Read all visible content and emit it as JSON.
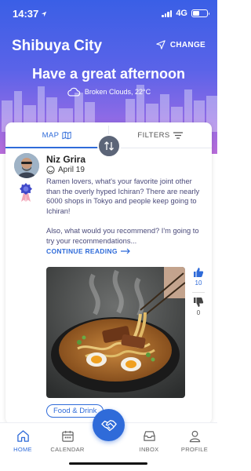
{
  "status_bar": {
    "time": "14:37",
    "network": "4G"
  },
  "header": {
    "city": "Shibuya City",
    "change_label": "CHANGE",
    "greeting": "Have a great afternoon",
    "weather": "Broken Clouds, 22°C"
  },
  "tabs": {
    "map_label": "MAP",
    "filters_label": "FILTERS"
  },
  "post": {
    "author": "Niz Grira",
    "date": "April 19",
    "paragraph1": "Ramen lovers, what's your favorite joint other than the overly hyped Ichiran? There are nearly 6000 shops in Tokyo and people keep going to Ichiran!",
    "paragraph2": "Also, what would you recommend? I'm going to try your recommendations...",
    "continue_label": "CONTINUE READING",
    "upvotes": "10",
    "downvotes": "0",
    "tag": "Food & Drink"
  },
  "nav": {
    "home": "HOME",
    "calendar": "CALENDAR",
    "inbox": "INBOX",
    "profile": "PROFILE"
  },
  "colors": {
    "accent": "#2f6bd9",
    "gradient_top": "#3a5fe6",
    "gradient_bottom": "#b86cd9"
  }
}
